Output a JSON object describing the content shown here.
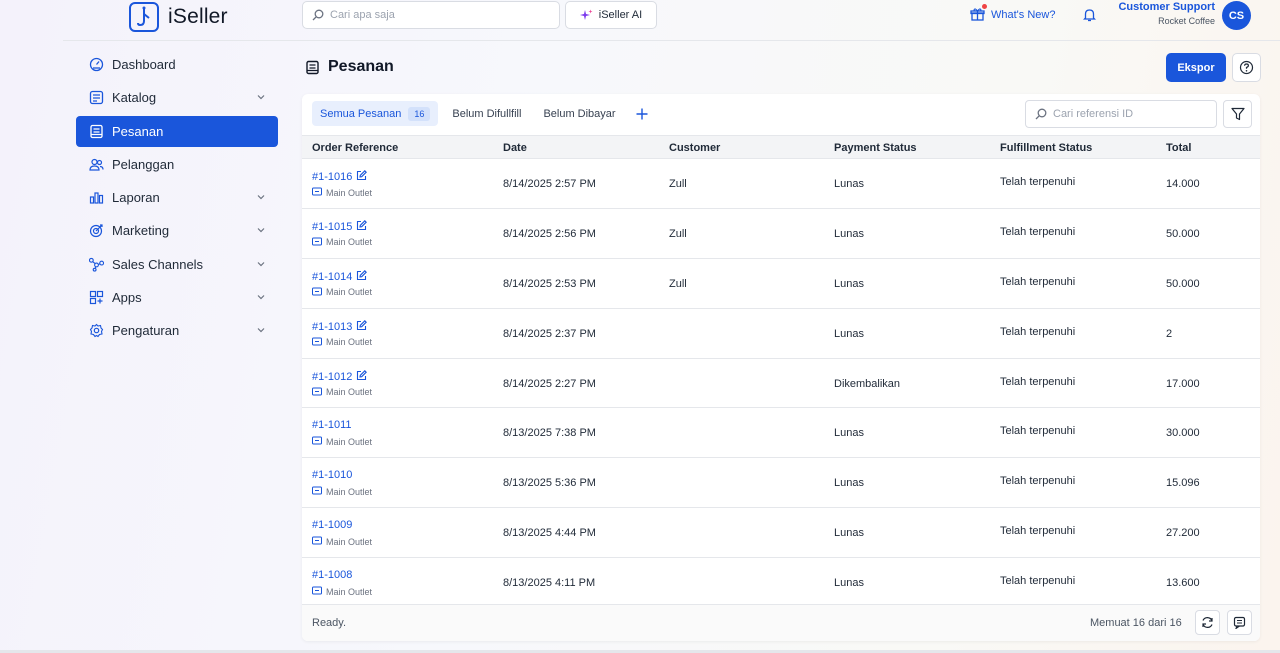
{
  "app": {
    "name": "iSeller"
  },
  "header": {
    "search_placeholder": "Cari apa saja",
    "ai_label": "iSeller AI",
    "whats_new": "What's New?",
    "user_name": "Customer Support",
    "store_name": "Rocket Coffee",
    "avatar_initials": "CS"
  },
  "sidebar": {
    "items": [
      {
        "label": "Dashboard",
        "icon": "dashboard-icon"
      },
      {
        "label": "Katalog",
        "icon": "catalog-icon"
      },
      {
        "label": "Pesanan",
        "icon": "orders-icon"
      },
      {
        "label": "Pelanggan",
        "icon": "customers-icon"
      },
      {
        "label": "Laporan",
        "icon": "reports-icon"
      },
      {
        "label": "Marketing",
        "icon": "marketing-icon"
      },
      {
        "label": "Sales Channels",
        "icon": "sales-channels-icon"
      },
      {
        "label": "Apps",
        "icon": "apps-icon"
      },
      {
        "label": "Pengaturan",
        "icon": "settings-icon"
      }
    ]
  },
  "page": {
    "title": "Pesanan",
    "export_label": "Ekspor"
  },
  "tabs": {
    "all": "Semua Pesanan",
    "all_count": "16",
    "unfulfilled": "Belum Difullfill",
    "unpaid": "Belum Dibayar"
  },
  "ref_search_placeholder": "Cari referensi ID",
  "table": {
    "columns": [
      "Order Reference",
      "Date",
      "Customer",
      "Payment Status",
      "Fulfillment Status",
      "Total"
    ],
    "rows": [
      {
        "ref": "#1-1016",
        "outlet": "Main Outlet",
        "date": "8/14/2025 2:57 PM",
        "customer": "Zull",
        "payment": "Lunas",
        "fulfillment": "Telah terpenuhi",
        "total": "14.000"
      },
      {
        "ref": "#1-1015",
        "outlet": "Main Outlet",
        "date": "8/14/2025 2:56 PM",
        "customer": "Zull",
        "payment": "Lunas",
        "fulfillment": "Telah terpenuhi",
        "total": "50.000"
      },
      {
        "ref": "#1-1014",
        "outlet": "Main Outlet",
        "date": "8/14/2025 2:53 PM",
        "customer": "Zull",
        "payment": "Lunas",
        "fulfillment": "Telah terpenuhi",
        "total": "50.000"
      },
      {
        "ref": "#1-1013",
        "outlet": "Main Outlet",
        "date": "8/14/2025 2:37 PM",
        "customer": "",
        "payment": "Lunas",
        "fulfillment": "Telah terpenuhi",
        "total": "2"
      },
      {
        "ref": "#1-1012",
        "outlet": "Main Outlet",
        "date": "8/14/2025 2:27 PM",
        "customer": "",
        "payment": "Dikembalikan",
        "fulfillment": "Telah terpenuhi",
        "total": "17.000"
      },
      {
        "ref": "#1-1011",
        "outlet": "Main Outlet",
        "date": "8/13/2025 7:38 PM",
        "customer": "",
        "payment": "Lunas",
        "fulfillment": "Telah terpenuhi",
        "total": "30.000"
      },
      {
        "ref": "#1-1010",
        "outlet": "Main Outlet",
        "date": "8/13/2025 5:36 PM",
        "customer": "",
        "payment": "Lunas",
        "fulfillment": "Telah terpenuhi",
        "total": "15.096"
      },
      {
        "ref": "#1-1009",
        "outlet": "Main Outlet",
        "date": "8/13/2025 4:44 PM",
        "customer": "",
        "payment": "Lunas",
        "fulfillment": "Telah terpenuhi",
        "total": "27.200"
      },
      {
        "ref": "#1-1008",
        "outlet": "Main Outlet",
        "date": "8/13/2025 4:11 PM",
        "customer": "",
        "payment": "Lunas",
        "fulfillment": "Telah terpenuhi",
        "total": "13.600"
      }
    ],
    "editable_rows": [
      true,
      true,
      true,
      true,
      true,
      false,
      false,
      false,
      false
    ]
  },
  "footer": {
    "status": "Ready.",
    "page_info": "Memuat 16 dari 16"
  },
  "colors": {
    "accent": "#1a56db",
    "notification": "#ef4444"
  }
}
